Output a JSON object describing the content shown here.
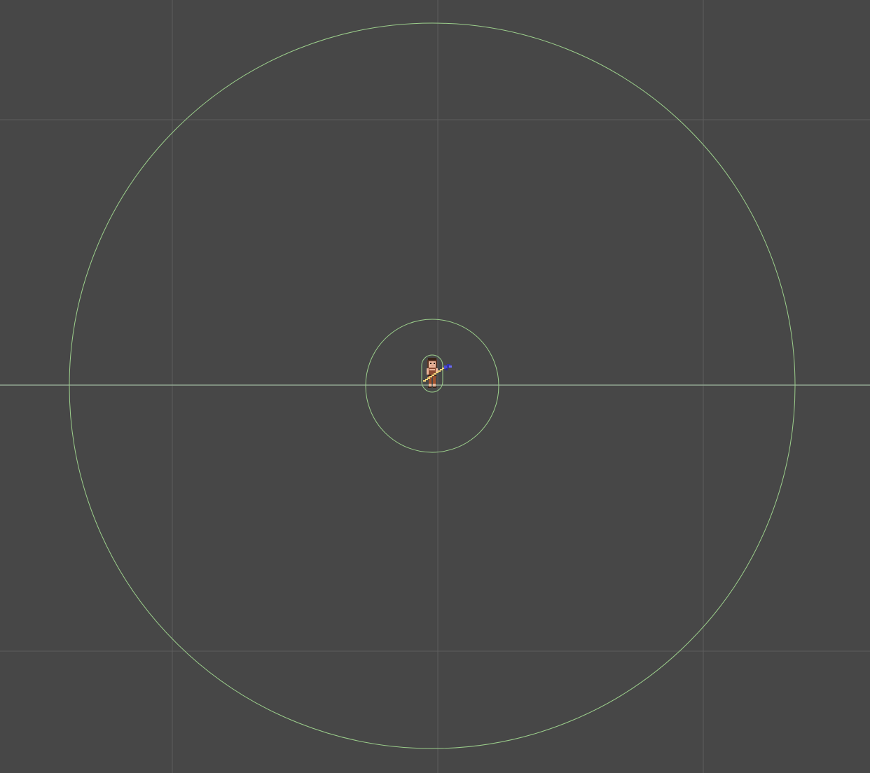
{
  "scene": {
    "background_color": "#474747",
    "grid_color": "#5e5e5e",
    "axis_color": "#9fb99f",
    "gizmo_color": "#9ccf8c"
  },
  "character": {
    "icon": "pixel-adventurer-with-spear-icon",
    "skin_color": "#e8b49a",
    "hair_color": "#5a3524",
    "tunic_color": "#8b4a32",
    "spear_shaft_color": "#f2d27a",
    "spear_tip_color": "#4a4ad8"
  }
}
